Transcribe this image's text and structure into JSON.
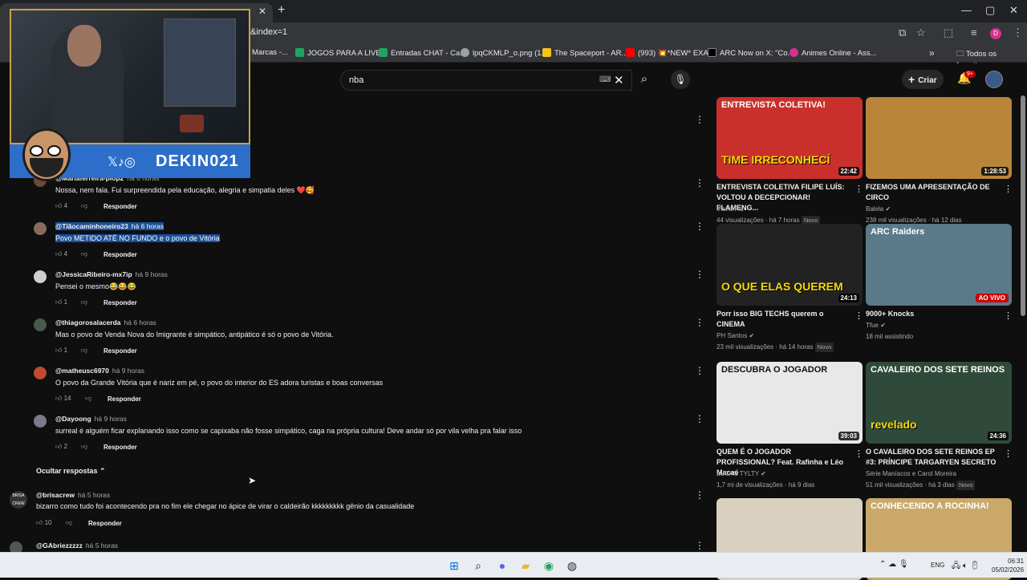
{
  "browser": {
    "url_fragment": "&index=1",
    "new_tab": "+",
    "window_controls": [
      "—",
      "▢",
      "✕"
    ],
    "profile_initial": "D",
    "bookmarks": [
      {
        "label": "Marcas -...",
        "color": "#3b82f6"
      },
      {
        "label": "JOGOS PARA A LIVE...",
        "color": "#1ea362"
      },
      {
        "label": "Entradas CHAT - Ca...",
        "color": "#1ea362"
      },
      {
        "label": "lpqCKMLP_o.png (1...",
        "color": "#9aa0a6"
      },
      {
        "label": "The Spaceport - AR...",
        "color": "#f5c518"
      },
      {
        "label": "(993) 💥*NEW* EXA...",
        "color": "#ff0000"
      },
      {
        "label": "ARC Now on X: \"Co...",
        "color": "#000000"
      },
      {
        "label": "Animes Online - Ass...",
        "color": "#d6318d"
      }
    ],
    "all_bookmarks": "Todos os favoritos"
  },
  "yt": {
    "search_value": "nba",
    "create_label": "Criar",
    "notifications_badge": "9+"
  },
  "stream": {
    "handle": "DEKIN021",
    "social_icons": "𝕏♪◎"
  },
  "comments": [
    {
      "author": "@Mariaferreira-plop2",
      "time": "há 6 horas",
      "text": "Nossa, nem fala. Fui surpreendida pela educação, alegria e simpatia deles ❤️🥰",
      "likes": "4",
      "reply": "Responder",
      "avatar_color": "#6b4a3a",
      "selected": false
    },
    {
      "author": "@Tiãocaminhoneiro23",
      "time": "há 6 horas",
      "text": "Povo METIDO ATÉ NO FUNDO e o povo de Vitória",
      "likes": "4",
      "reply": "Responder",
      "avatar_color": "#8a6a5a",
      "selected": true
    },
    {
      "author": "@JessicaRibeiro-mx7ip",
      "time": "há 9 horas",
      "text": "Pensei o mesmo😂😂😂",
      "likes": "1",
      "reply": "Responder",
      "avatar_color": "#cfcfcf",
      "selected": false
    },
    {
      "author": "@thiagorosalacerda",
      "time": "há 6 horas",
      "text": "Mas o povo de Venda Nova do Imigrante é simpático, antipático é só o povo de Vitória.",
      "likes": "1",
      "reply": "Responder",
      "avatar_color": "#4a5a4a",
      "selected": false
    },
    {
      "author": "@matheusc6970",
      "time": "há 9 horas",
      "text": "O povo da Grande Vitória que é nariz em pé, o povo do interior do ES adora turistas e boas conversas",
      "likes": "14",
      "reply": "Responder",
      "avatar_color": "#c0492f",
      "selected": false
    },
    {
      "author": "@Dayoong",
      "time": "há 9 horas",
      "text": "surreal é alguém ficar explanando isso como se capixaba não fosse simpático, caga na própria cultura! Deve andar só por vila velha pra falar isso",
      "likes": "2",
      "reply": "Responder",
      "avatar_color": "#7a7a8a",
      "selected": false
    }
  ],
  "hide_replies": "Ocultar respostas",
  "top_comments": [
    {
      "author": "@brisacrew",
      "time": "há 5 horas",
      "text": "bizarro como tudo foi acontecendo pra no fim ele chegar no ápice de virar o caldeirão kkkkkkkkk gênio da casualidade",
      "likes": "10",
      "reply": "Responder",
      "avatar_label": "BRISA CREW"
    },
    {
      "author": "@GAbriezzzzz",
      "time": "há 5 horas",
      "text": "",
      "likes": "",
      "reply": "",
      "avatar_label": ""
    }
  ],
  "videos": [
    {
      "title": "ENTREVISTA COLETIVA FILIPE LUÍS: VOLTOU A DECEPCIONAR! FLAMENG...",
      "channel": "Vieira Fla",
      "verified": false,
      "meta": "44 visualizações · há 7 horas",
      "badge": "Novo",
      "duration": "22:42",
      "thumb_top": "ENTREVISTA COLETIVA!",
      "thumb_bottom": "TIME IRRECONHECÍ",
      "bg": "#c9302c"
    },
    {
      "title": "FIZEMOS UMA APRESENTAÇÃO DE CIRCO",
      "channel": "Balela",
      "verified": true,
      "meta": "238 mil visualizações · há 12 dias",
      "badge": "",
      "duration": "1:28:53",
      "thumb_top": "",
      "thumb_bottom": "",
      "bg": "#b8853a"
    },
    {
      "title": "Porr isso BIG TECHS querem o CINEMA",
      "channel": "PH Santos",
      "verified": true,
      "meta": "23 mil visualizações · há 14 horas",
      "badge": "Novo",
      "duration": "24:13",
      "thumb_top": "",
      "thumb_bottom": "O QUE ELAS QUEREM",
      "bg": "#222222"
    },
    {
      "title": "9000+ Knocks",
      "channel": "Tfue",
      "verified": true,
      "meta": "18 mil assistindo",
      "badge": "",
      "duration": "AO VIVO",
      "thumb_top": "ARC Raiders",
      "thumb_bottom": "",
      "bg": "#5a7a8a"
    },
    {
      "title": "QUEM É O JOGADOR PROFISSIONAL? Feat. Rafinha e Léo Macaé",
      "channel": "LUCAS TYLTY",
      "verified": true,
      "meta": "1,7 mi de visualizações · há 9 dias",
      "badge": "",
      "duration": "39:03",
      "thumb_top": "DESCUBRA O JOGADOR",
      "thumb_bottom": "",
      "bg": "#e8e8e8"
    },
    {
      "title": "O CAVALEIRO DOS SETE REINOS EP #3: PRÍNCIPE TARGARYEN SECRETO",
      "channel": "Série Maníacos",
      "verified": false,
      "meta": "51 mil visualizações · há 3 dias",
      "badge": "Novo",
      "duration": "24:36",
      "thumb_top": "CAVALEIRO DOS SETE REINOS",
      "thumb_bottom": "revelado",
      "bg": "#2f4a3a"
    },
    {
      "title": "",
      "channel": "",
      "verified": false,
      "meta": "",
      "badge": "",
      "duration": "",
      "thumb_top": "",
      "thumb_bottom": "",
      "bg": "#d9d0c0"
    },
    {
      "title": "",
      "channel": "",
      "verified": false,
      "meta": "",
      "badge": "",
      "duration": "",
      "thumb_top": "CONHECENDO A ROCINHA!",
      "thumb_bottom": "",
      "bg": "#c9a86a"
    }
  ],
  "video_extra": {
    "channel_suffix_5": "e Carol Moreira"
  },
  "taskbar": {
    "lang": "ENG",
    "time": "06:31",
    "date": "05/02/2026"
  }
}
